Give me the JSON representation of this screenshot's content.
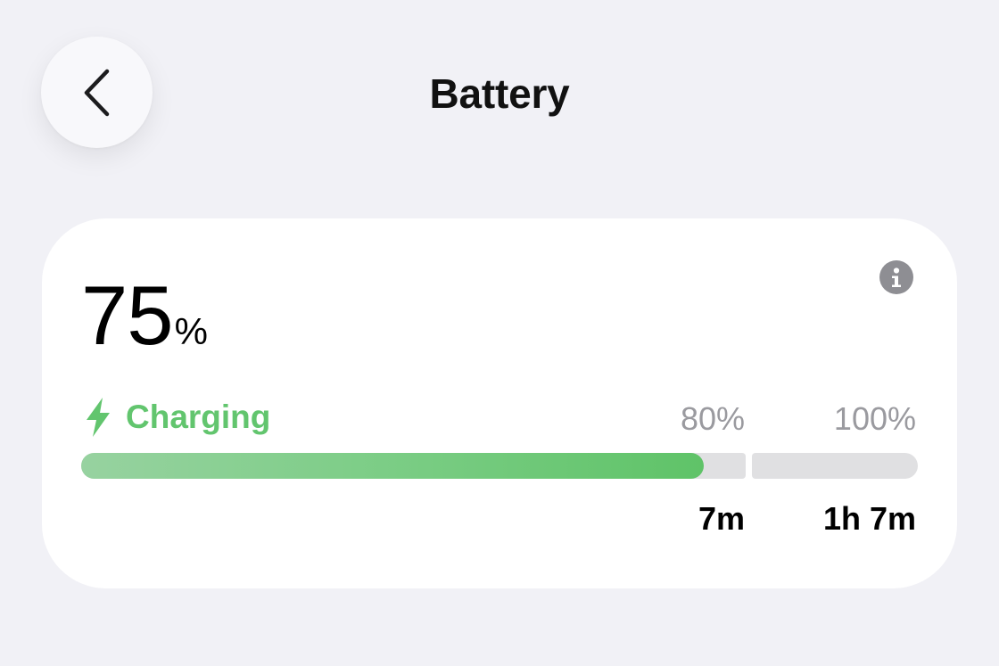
{
  "header": {
    "title": "Battery",
    "back_icon": "chevron-left-icon"
  },
  "battery": {
    "level_value": "75",
    "level_unit": "%",
    "status_label": "Charging",
    "status_icon": "bolt-icon",
    "status_color": "#62c56e",
    "info_icon": "info-icon",
    "charge_fraction": 0.75,
    "milestones": [
      {
        "label": "80%",
        "time": "7m"
      },
      {
        "label": "100%",
        "time": "1h 7m"
      }
    ]
  }
}
